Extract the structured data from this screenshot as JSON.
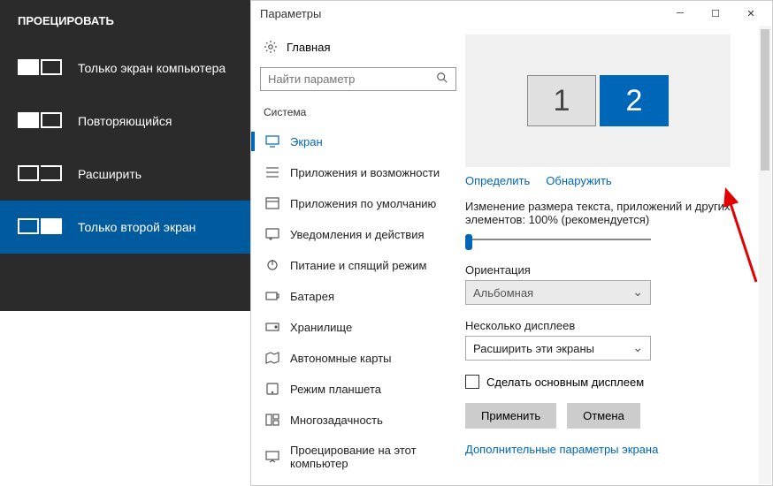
{
  "flyout": {
    "title": "ПРОЕЦИРОВАТЬ",
    "items": [
      {
        "label": "Только экран компьютера"
      },
      {
        "label": "Повторяющийся"
      },
      {
        "label": "Расширить"
      },
      {
        "label": "Только второй экран"
      }
    ],
    "selected_index": 3
  },
  "settings": {
    "window_title": "Параметры",
    "home": "Главная",
    "search_placeholder": "Найти параметр",
    "section": "Система",
    "nav": [
      {
        "label": "Экран"
      },
      {
        "label": "Приложения и возможности"
      },
      {
        "label": "Приложения по умолчанию"
      },
      {
        "label": "Уведомления и действия"
      },
      {
        "label": "Питание и спящий режим"
      },
      {
        "label": "Батарея"
      },
      {
        "label": "Хранилище"
      },
      {
        "label": "Автономные карты"
      },
      {
        "label": "Режим планшета"
      },
      {
        "label": "Многозадачность"
      },
      {
        "label": "Проецирование на этот компьютер"
      }
    ],
    "selected_nav": 0
  },
  "display": {
    "monitors": [
      "1",
      "2"
    ],
    "identify": "Определить",
    "detect": "Обнаружить",
    "scale_label": "Изменение размера текста, приложений и других элементов: 100% (рекомендуется)",
    "orientation_label": "Ориентация",
    "orientation_value": "Альбомная",
    "multi_label": "Несколько дисплеев",
    "multi_value": "Расширить эти экраны",
    "make_main": "Сделать основным дисплеем",
    "apply": "Применить",
    "cancel": "Отмена",
    "advanced": "Дополнительные параметры экрана"
  }
}
